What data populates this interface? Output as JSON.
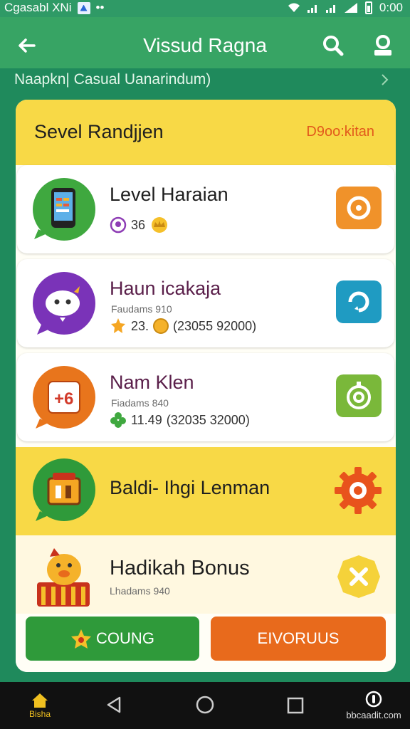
{
  "statusbar": {
    "left_text": "Cgasabl XNi",
    "dots": "••",
    "time": "0:00"
  },
  "appbar": {
    "title": "Vissud Ragna"
  },
  "subheader": {
    "text": "Naapkn| Casual Uanarindum)"
  },
  "card": {
    "title": "Sevel Randjjen",
    "link": "D9oo:kitan"
  },
  "items": [
    {
      "name": "Level Haraian",
      "sub": "",
      "meta_value": "36",
      "meta_extra": ""
    },
    {
      "name": "Haun icakaja",
      "sub": "Faudams 910",
      "meta_value": "23.",
      "meta_extra": "(23055 92000)"
    },
    {
      "name": "Nam Klen",
      "sub": "Fiadams 840",
      "meta_value": "11.49",
      "meta_extra": "(32035 32000)"
    }
  ],
  "yellow_row": {
    "name": "Baldi- Ihgi Lenman"
  },
  "bonus_row": {
    "name": "Hadikah Bonus",
    "sub": "Lhadams 940"
  },
  "actions": {
    "green": "COUNG",
    "orange": "EIVORUUS"
  },
  "navbar": {
    "home_label": "Bisha",
    "right_label": "bbcaadit.com"
  },
  "colors": {
    "appbar": "#37a464",
    "background": "#1f8a5c",
    "header_yellow": "#f8d946",
    "orange": "#e86a1c",
    "green_button": "#2f9a3a",
    "teal_button": "#1f9bc2",
    "lime_button": "#7ab83a"
  },
  "icons": {
    "back": "arrow-left-icon",
    "search": "search-icon",
    "profile": "profile-icon",
    "phone": "phone-app-icon",
    "ghost": "ghost-app-icon",
    "dice": "dice-app-icon",
    "treasure": "treasure-app-icon",
    "mascot": "mascot-icon"
  }
}
